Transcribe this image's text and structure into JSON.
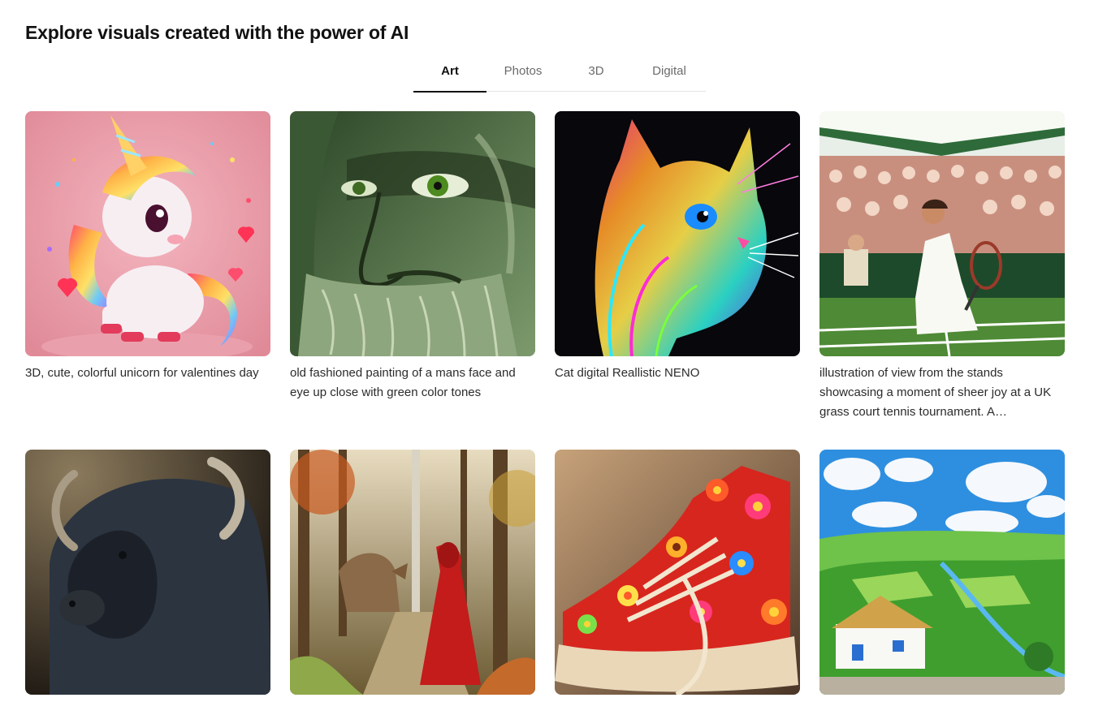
{
  "header": {
    "title": "Explore visuals created with the power of AI"
  },
  "tabs": [
    {
      "label": "Art",
      "active": true
    },
    {
      "label": "Photos",
      "active": false
    },
    {
      "label": "3D",
      "active": false
    },
    {
      "label": "Digital",
      "active": false
    }
  ],
  "cards": [
    {
      "caption": "3D, cute, colorful unicorn for valentines day"
    },
    {
      "caption": "old fashioned painting of a mans face and eye up close with green color tones"
    },
    {
      "caption": "Cat digital Reallistic NENO"
    },
    {
      "caption": "illustration of view from the stands showcasing a moment of sheer joy at a UK grass court tennis tournament. A…"
    },
    {
      "caption": ""
    },
    {
      "caption": ""
    },
    {
      "caption": ""
    },
    {
      "caption": ""
    }
  ],
  "colors": {
    "active_tab": "#111111",
    "inactive_tab": "#6b6b6b",
    "tab_border": "#e4e4e4"
  }
}
